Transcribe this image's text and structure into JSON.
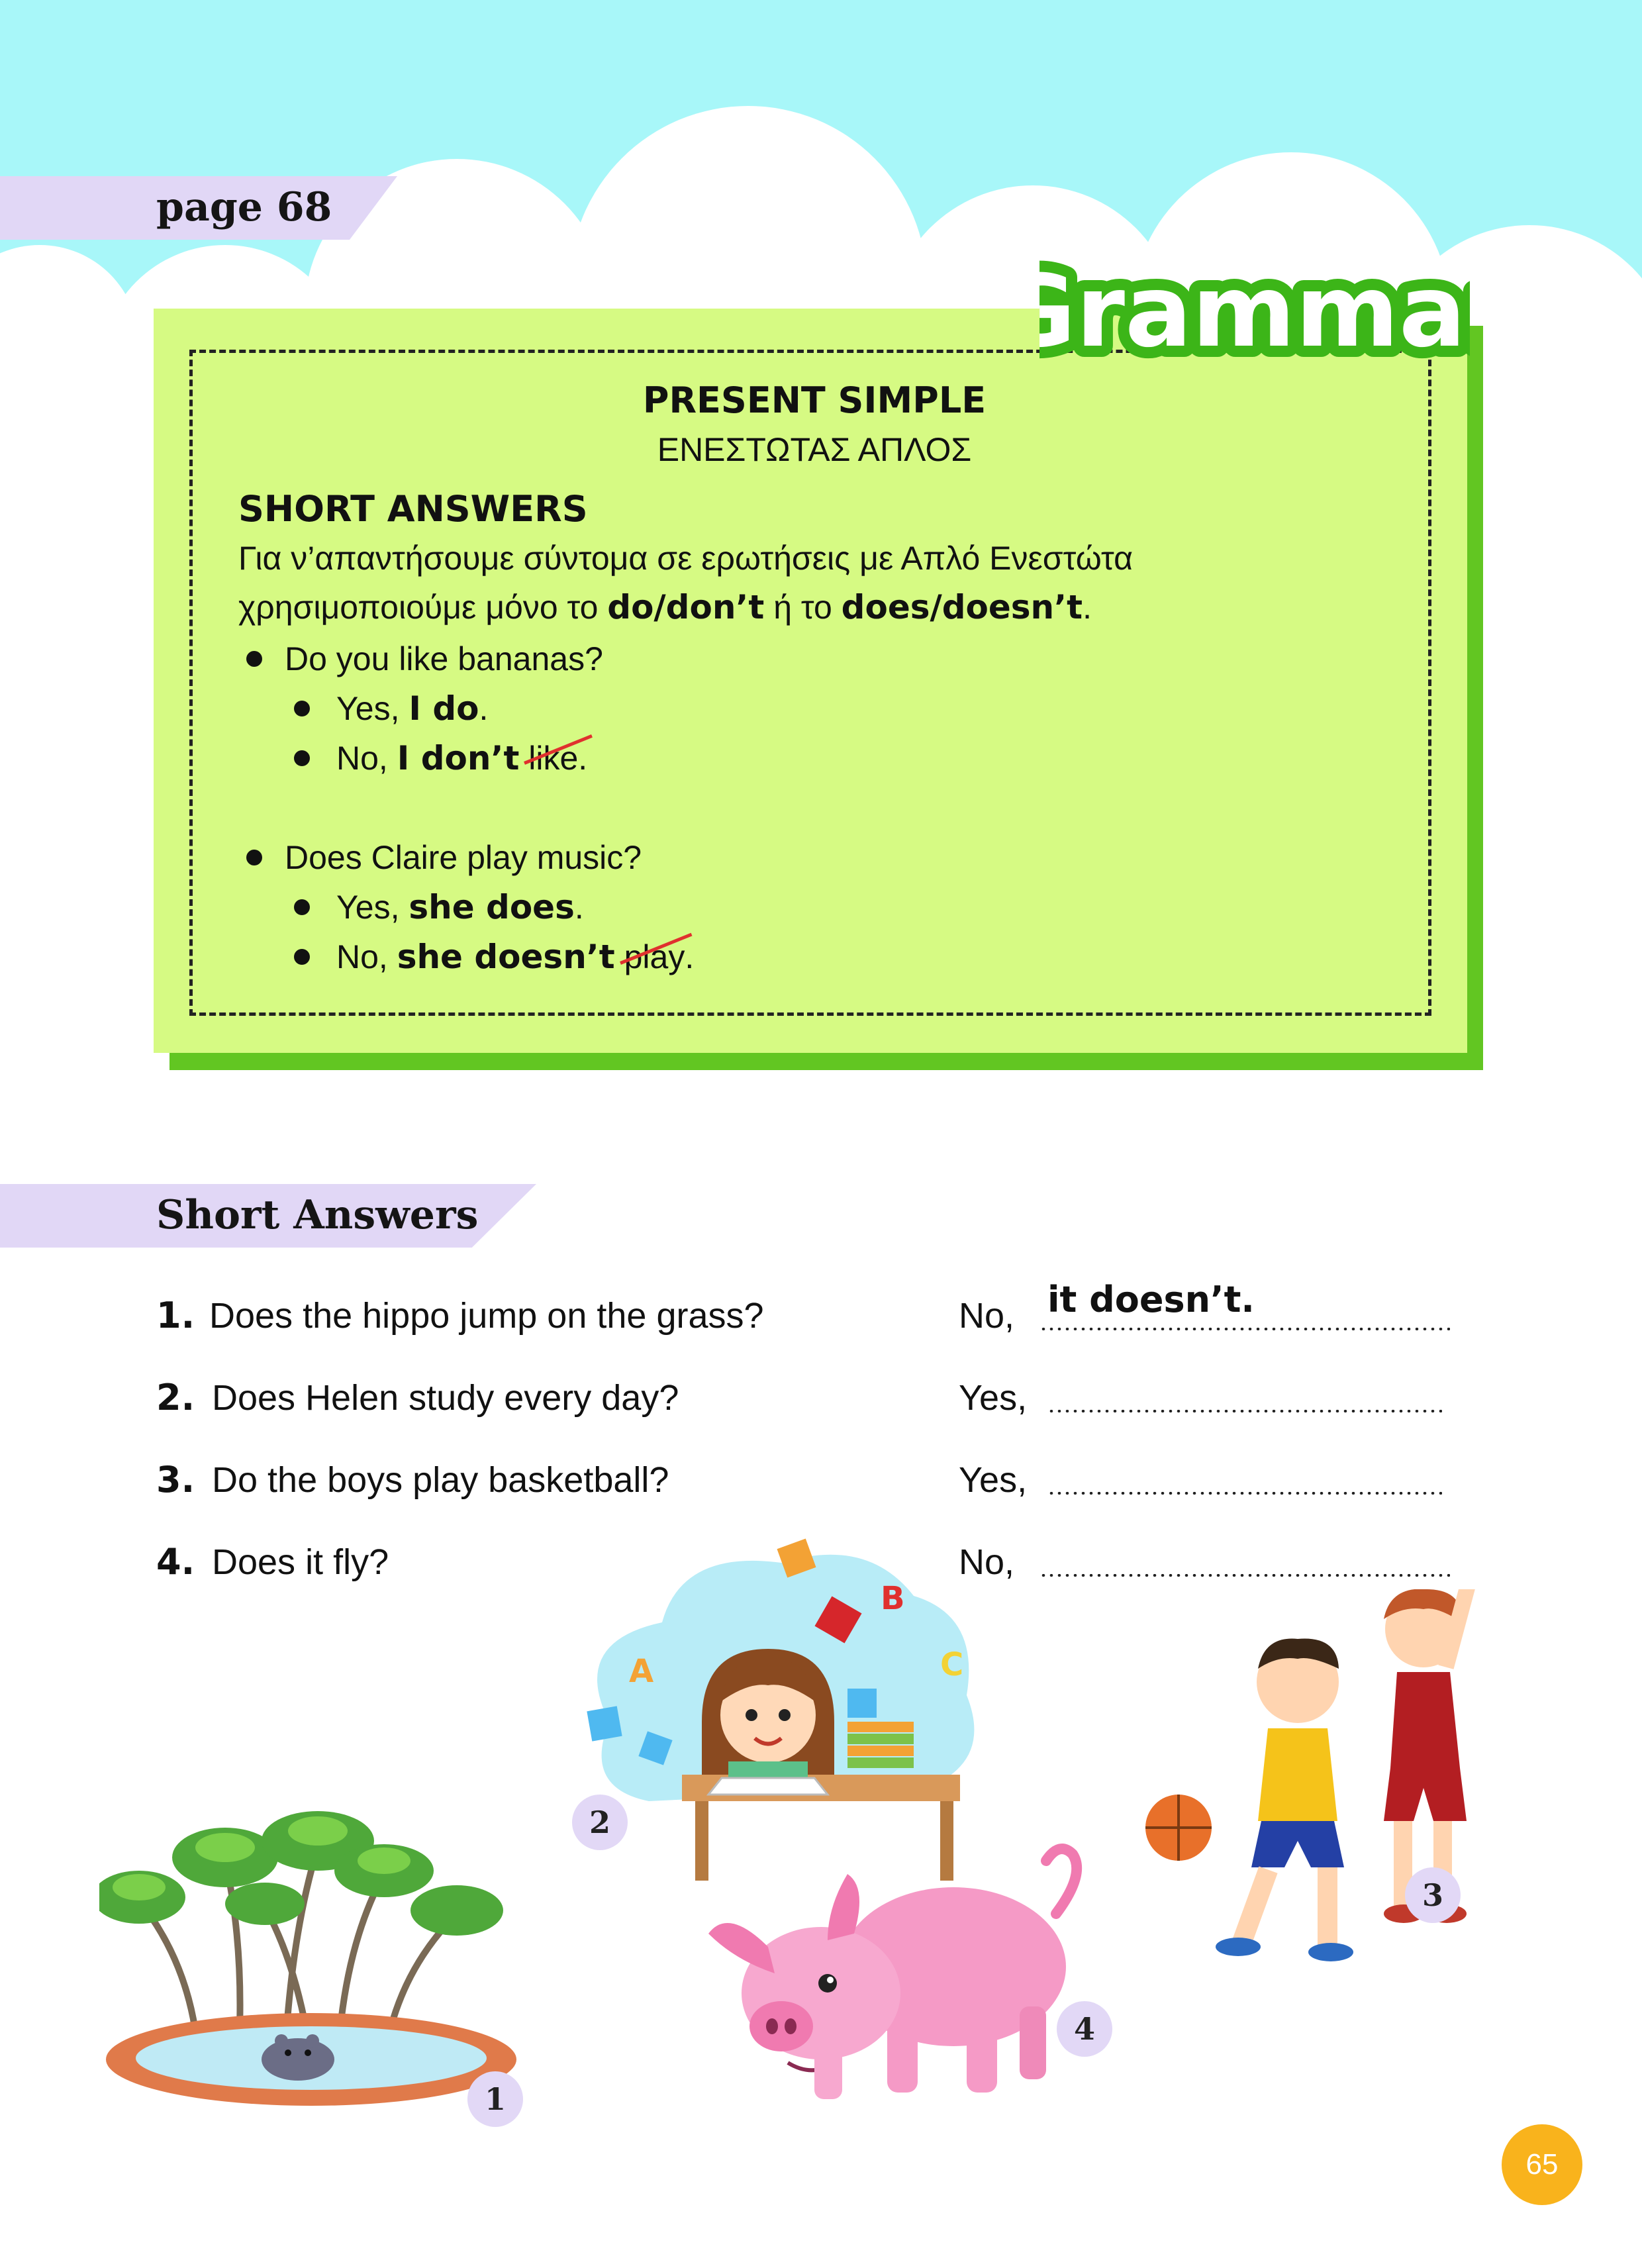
{
  "page_tag": "page 68",
  "grammar_title": "Grammar",
  "grammar_box": {
    "heading": "PRESENT SIMPLE",
    "heading_greek": "ΕΝΕΣΤΩΤΑΣ ΑΠΛΟΣ",
    "subheading": "SHORT ANSWERS",
    "explain_line1": "Για ν’απαντήσουμε σύντομα σε ερωτήσεις με Απλό Ενεστώτα",
    "explain_line2_pre": "χρησιμοποιούμε μόνο το ",
    "explain_line2_bold1": "do/don’t",
    "explain_line2_mid": " ή το ",
    "explain_line2_bold2": "does/doesn’t",
    "explain_line2_end": ".",
    "example1": {
      "question": "Do you like bananas?",
      "yes_pre": "Yes, ",
      "yes_bold": "I do",
      "yes_end": ".",
      "no_pre": "No, ",
      "no_bold": "I don’t",
      "no_struck": "like",
      "no_end": "."
    },
    "example2": {
      "question": "Does Claire play music?",
      "yes_pre": "Yes, ",
      "yes_bold": "she does",
      "yes_end": ".",
      "no_pre": "No, ",
      "no_bold": "she doesn’t",
      "no_struck": "play",
      "no_end": "."
    }
  },
  "exercise": {
    "title": "Short Answers",
    "items": [
      {
        "num": "1.",
        "question": "Does the hippo jump on the grass?",
        "answer_prefix": "No,",
        "answer_filled": "it doesn’t."
      },
      {
        "num": "2.",
        "question": "Does Helen study every day?",
        "answer_prefix": "Yes,",
        "answer_filled": ""
      },
      {
        "num": "3.",
        "question": "Do the boys play basketball?",
        "answer_prefix": "Yes,",
        "answer_filled": ""
      },
      {
        "num": "4.",
        "question": "Does it fly?",
        "answer_prefix": "No,",
        "answer_filled": ""
      }
    ]
  },
  "badges": [
    "1",
    "2",
    "3",
    "4"
  ],
  "page_number": "65",
  "colors": {
    "sky": "#a8f7f9",
    "grammar_box": "#d6fa83",
    "grammar_shadow": "#62c622",
    "tag": "#e1d7f6",
    "page_number": "#f9b31c",
    "strike": "#e0302e"
  }
}
